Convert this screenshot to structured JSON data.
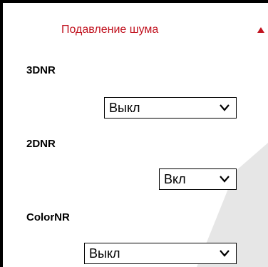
{
  "colors": {
    "accent": "#c1121f",
    "border": "#000000",
    "background": "#ffffff",
    "watermark": "#e6e6e6"
  },
  "section": {
    "title": "Подавление шума",
    "toggle_icon": "triangle-up-icon",
    "expanded": true
  },
  "settings": [
    {
      "label": "3DNR",
      "value": "Выкл"
    },
    {
      "label": "2DNR",
      "value": "Вкл"
    },
    {
      "label": "ColorNR",
      "value": "Выкл"
    }
  ],
  "select_icon": "chevron-down-icon"
}
